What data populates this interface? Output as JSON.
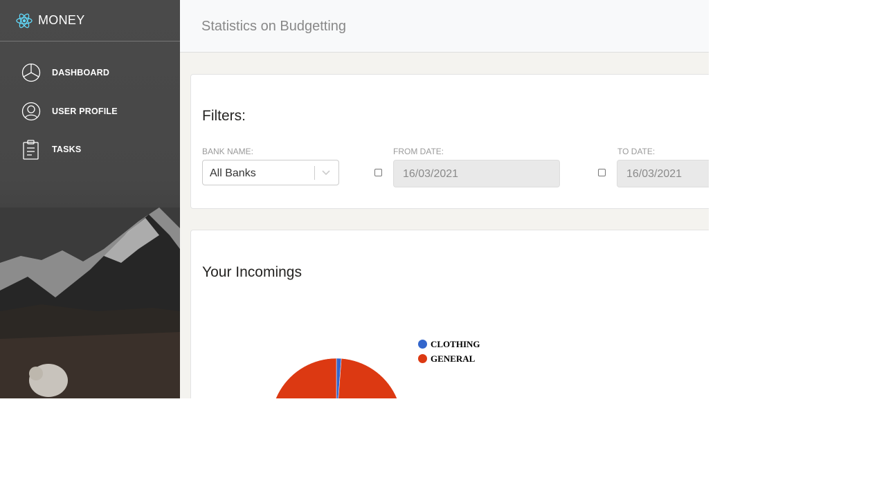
{
  "brand": {
    "name": "MONEY",
    "logo_icon": "react-atom-icon",
    "logo_color": "#61dafb"
  },
  "sidebar": {
    "items": [
      {
        "label": "DASHBOARD",
        "icon": "pie-chart-icon"
      },
      {
        "label": "USER PROFILE",
        "icon": "user-circle-icon"
      },
      {
        "label": "TASKS",
        "icon": "clipboard-icon"
      }
    ]
  },
  "topbar": {
    "title": "Statistics on Budgetting"
  },
  "filters": {
    "title": "Filters:",
    "bank": {
      "label": "BANK NAME:",
      "value": "All Banks"
    },
    "from": {
      "label": "FROM DATE:",
      "value": "16/03/2021",
      "enabled": false
    },
    "to": {
      "label": "TO DATE:",
      "value": "16/03/2021",
      "enabled": false
    }
  },
  "incomings": {
    "title": "Your Incomings"
  },
  "chart_data": {
    "type": "pie",
    "title": "",
    "slices": [
      {
        "name": "CLOTHING",
        "value": 1.2,
        "color": "#3366cc"
      },
      {
        "name": "GENERAL",
        "value": 98.8,
        "color": "#dc3912"
      }
    ]
  }
}
